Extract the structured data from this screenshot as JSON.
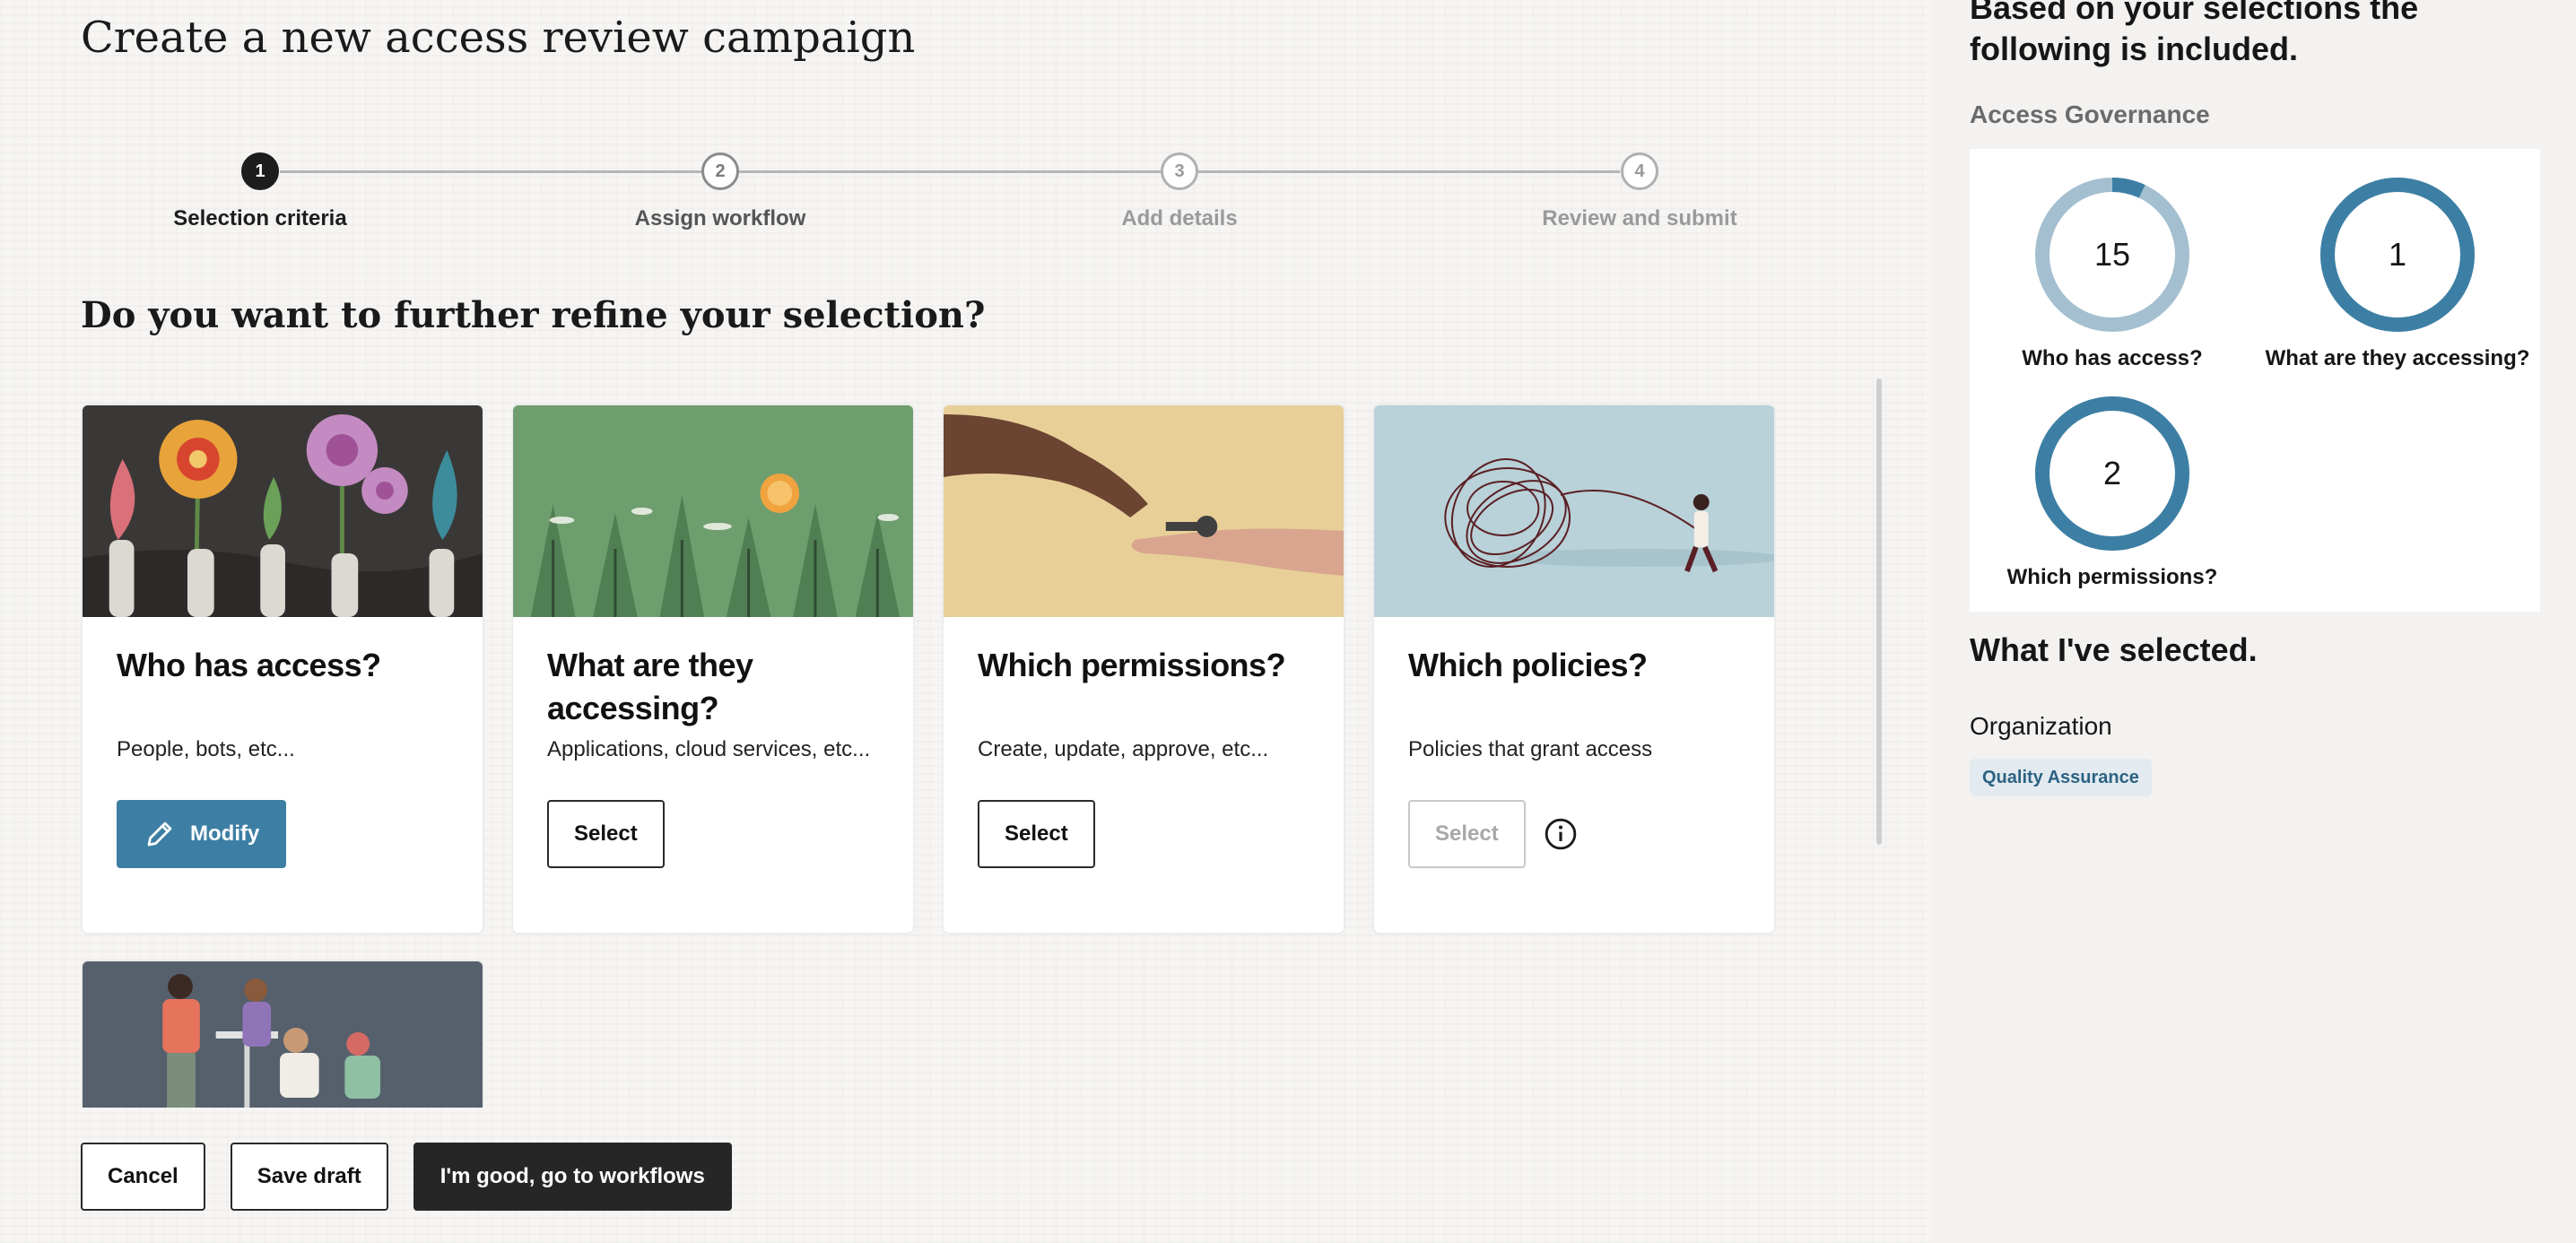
{
  "page": {
    "title": "Create a new access review campaign",
    "subtitle": "Do you want to further refine your selection?"
  },
  "stepper": {
    "steps": [
      {
        "number": "1",
        "label": "Selection criteria",
        "state": "active"
      },
      {
        "number": "2",
        "label": "Assign workflow",
        "state": "next"
      },
      {
        "number": "3",
        "label": "Add details",
        "state": "inactive"
      },
      {
        "number": "4",
        "label": "Review and submit",
        "state": "inactive"
      }
    ]
  },
  "cards": [
    {
      "title": "Who has access?",
      "description": "People, bots, etc...",
      "button": "Modify",
      "button_icon": "pencil-icon"
    },
    {
      "title": "What are they accessing?",
      "description": "Applications, cloud services, etc...",
      "button": "Select"
    },
    {
      "title": "Which permissions?",
      "description": "Create, update, approve, etc...",
      "button": "Select"
    },
    {
      "title": "Which policies?",
      "description": "Policies that grant access",
      "button": "Select",
      "button_disabled": true,
      "extra_icon": "info-icon"
    }
  ],
  "footer": {
    "cancel": "Cancel",
    "save_draft": "Save draft",
    "continue": "I'm good, go to workflows"
  },
  "sidebar": {
    "heading": "Based on your selections the following is included.",
    "section": "Access Governance",
    "stats": [
      {
        "value": "15",
        "label": "Who has access?",
        "fill": 0.93
      },
      {
        "value": "1",
        "label": "What are they accessing?",
        "fill": 1.0
      },
      {
        "value": "2",
        "label": "Which permissions?",
        "fill": 1.0
      }
    ],
    "selected_title": "What I've selected.",
    "org_label": "Organization",
    "org_value": "Quality Assurance"
  },
  "colors": {
    "accent_blue": "#3d7fa4",
    "ring_light": "#a4bfcf",
    "dark_button": "#262626",
    "badge_bg": "#e3ebf0"
  }
}
